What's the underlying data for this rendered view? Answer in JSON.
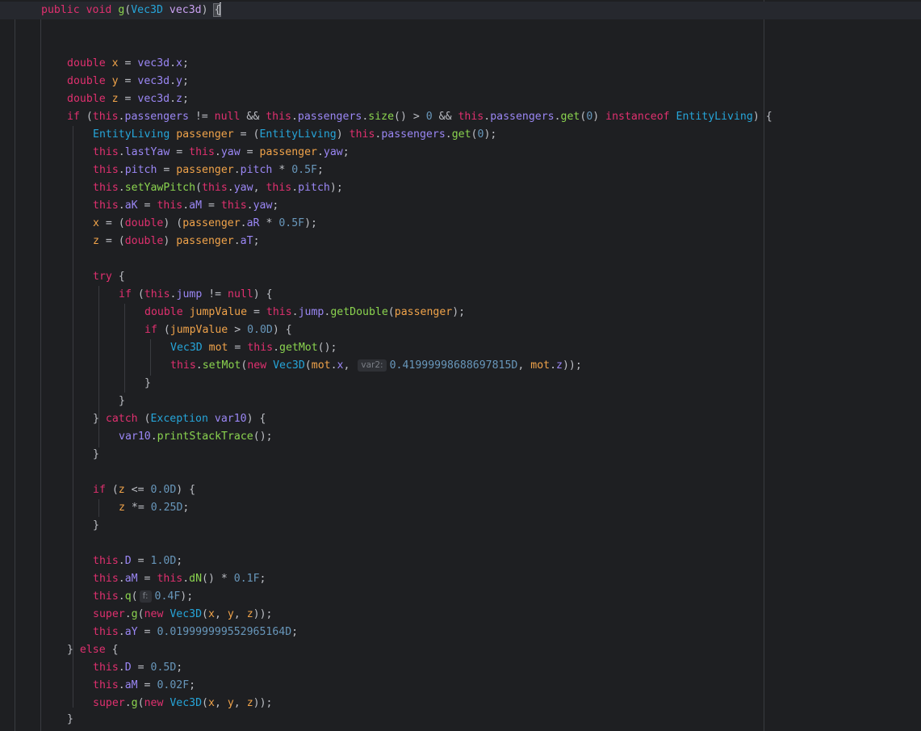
{
  "editor": {
    "hints": {
      "var2": "var2:",
      "f": "f:"
    },
    "lines": {
      "l1": {
        "public": "public",
        "void": "void",
        "name": "g",
        "open": "(",
        "type": "Vec3D",
        "param": "vec3d",
        "close": ")",
        "brace": "{"
      },
      "x": {
        "t": "double",
        "n": "x",
        "eq": " = ",
        "src": "vec3d",
        "dot": ".",
        "f": "x",
        "end": ";"
      },
      "y": {
        "t": "double",
        "n": "y",
        "eq": " = ",
        "src": "vec3d",
        "dot": ".",
        "f": "y",
        "end": ";"
      },
      "z": {
        "t": "double",
        "n": "z",
        "eq": " = ",
        "src": "vec3d",
        "dot": ".",
        "f": "z",
        "end": ";"
      },
      "if1": "if",
      "num": {
        "half": "0.5F",
        "zero_d": "0.0D",
        "jump_y": "0.41999998688697815D",
        "quarter": "0.25D",
        "one_d": "1.0D",
        "tenth": "0.1F",
        "fourtenth": "0.4F",
        "ay": "0.019999999552965164D",
        "half_d": "0.5D",
        "two_hund": "0.02F",
        "zero": "0"
      }
    }
  }
}
